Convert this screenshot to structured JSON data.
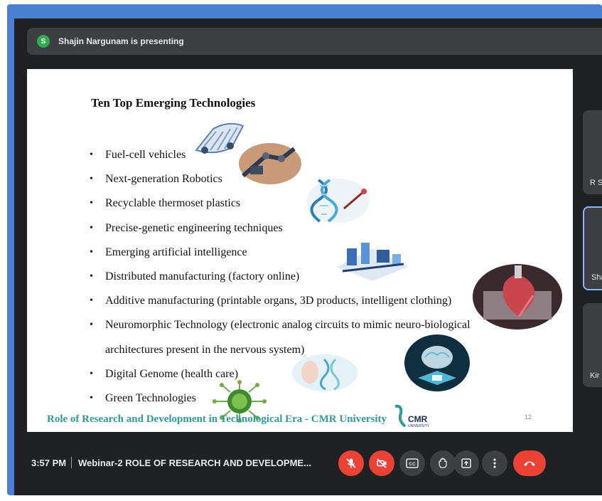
{
  "presenter": {
    "avatar_initial": "S",
    "status": "Shajin Nargunam is presenting"
  },
  "slide": {
    "title": "Ten Top Emerging Technologies",
    "bullets": [
      "Fuel-cell vehicles",
      "Next-generation Robotics",
      "Recyclable thermoset plastics",
      "Precise-genetic engineering techniques",
      "Emerging artificial intelligence",
      "Distributed manufacturing (factory online)",
      "Additive manufacturing (printable organs, 3D products, intelligent clothing)",
      "Neuromorphic Technology (electronic analog circuits to mimic neuro-biological",
      "Digital Genome (health care)",
      "Green Technologies"
    ],
    "bullet_continuation": "architectures present in the nervous system)",
    "footer": "Role of Research and Development in Technological Era - CMR University",
    "logo_text": "CMR",
    "logo_subtext": "UNIVERSITY",
    "page_number": "12"
  },
  "participants": [
    {
      "label": "R S"
    },
    {
      "label": "Sha"
    },
    {
      "label": "Kir"
    }
  ],
  "bottom_bar": {
    "time": "3:57 PM",
    "meeting_title": "Webinar-2 ROLE OF RESEARCH AND DEVELOPME...",
    "captions_label": "CC"
  },
  "colors": {
    "frame_border": "#4a7fd1",
    "app_background": "#202124",
    "footer_text": "#2e9a9a",
    "danger": "#ea4335",
    "avatar": "#34a853"
  }
}
